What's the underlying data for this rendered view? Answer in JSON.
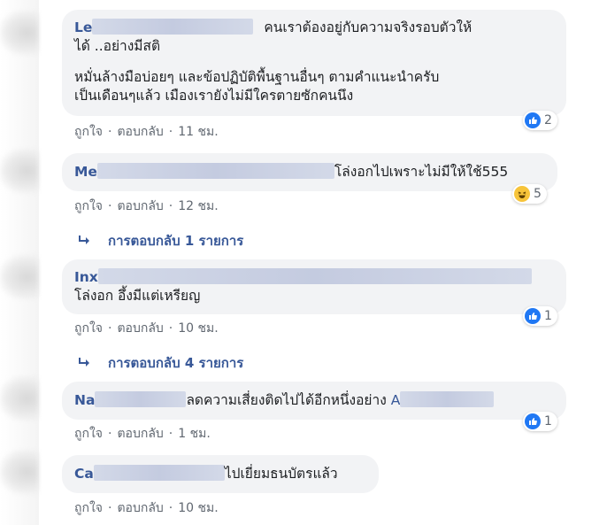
{
  "comments": [
    {
      "name": "Le",
      "text_line1": "คนเราต้องอยู่กับความจริงรอบตัวให้",
      "text_line2": "ได้ ..อย่างมีสติ",
      "text_line3": "หมั่นล้างมือบ่อยๆ และข้อปฏิบัติพื้นฐานอื่นๆ ตามคำแนะนำครับ",
      "text_line4": "เป็นเดือนๆแล้ว เมืองเรายังไม่มีใครตายซักคนนึง",
      "like": "ถูกใจ",
      "reply": "ตอบกลับ",
      "time": "11 ชม.",
      "reaction_icon": "like-icon",
      "reaction_count": "2"
    },
    {
      "name": "Me",
      "text": "โล่งอกไปเพราะไม่มีให้ใช้555",
      "like": "ถูกใจ",
      "reply": "ตอบกลับ",
      "time": "12 ชม.",
      "reaction_icon": "haha-icon",
      "reaction_count": "5",
      "replies_label": "การตอบกลับ 1 รายการ"
    },
    {
      "name": "Inx",
      "text": "โล่งอก อึ้งมีแต่เหรียญ",
      "like": "ถูกใจ",
      "reply": "ตอบกลับ",
      "time": "10 ชม.",
      "reaction_icon": "like-icon",
      "reaction_count": "1",
      "replies_label": "การตอบกลับ 4 รายการ"
    },
    {
      "name": "Na",
      "text": "ลดความเสี่ยงติดไปได้อีกหนึ่งอย่าง",
      "mention_initial": "A",
      "like": "ถูกใจ",
      "reply": "ตอบกลับ",
      "time": "1 ชม.",
      "reaction_icon": "like-icon",
      "reaction_count": "1"
    },
    {
      "name": "Ca",
      "text": "ไปเยี่ยมธนบัตรแล้ว",
      "like": "ถูกใจ",
      "reply": "ตอบกลับ",
      "time": "10 ชม."
    }
  ],
  "colors": {
    "bubble_bg": "#f2f3f5",
    "name": "#385898",
    "meta": "#606770",
    "like_blue": "#2078f4",
    "haha_yellow": "#f7c43a"
  }
}
